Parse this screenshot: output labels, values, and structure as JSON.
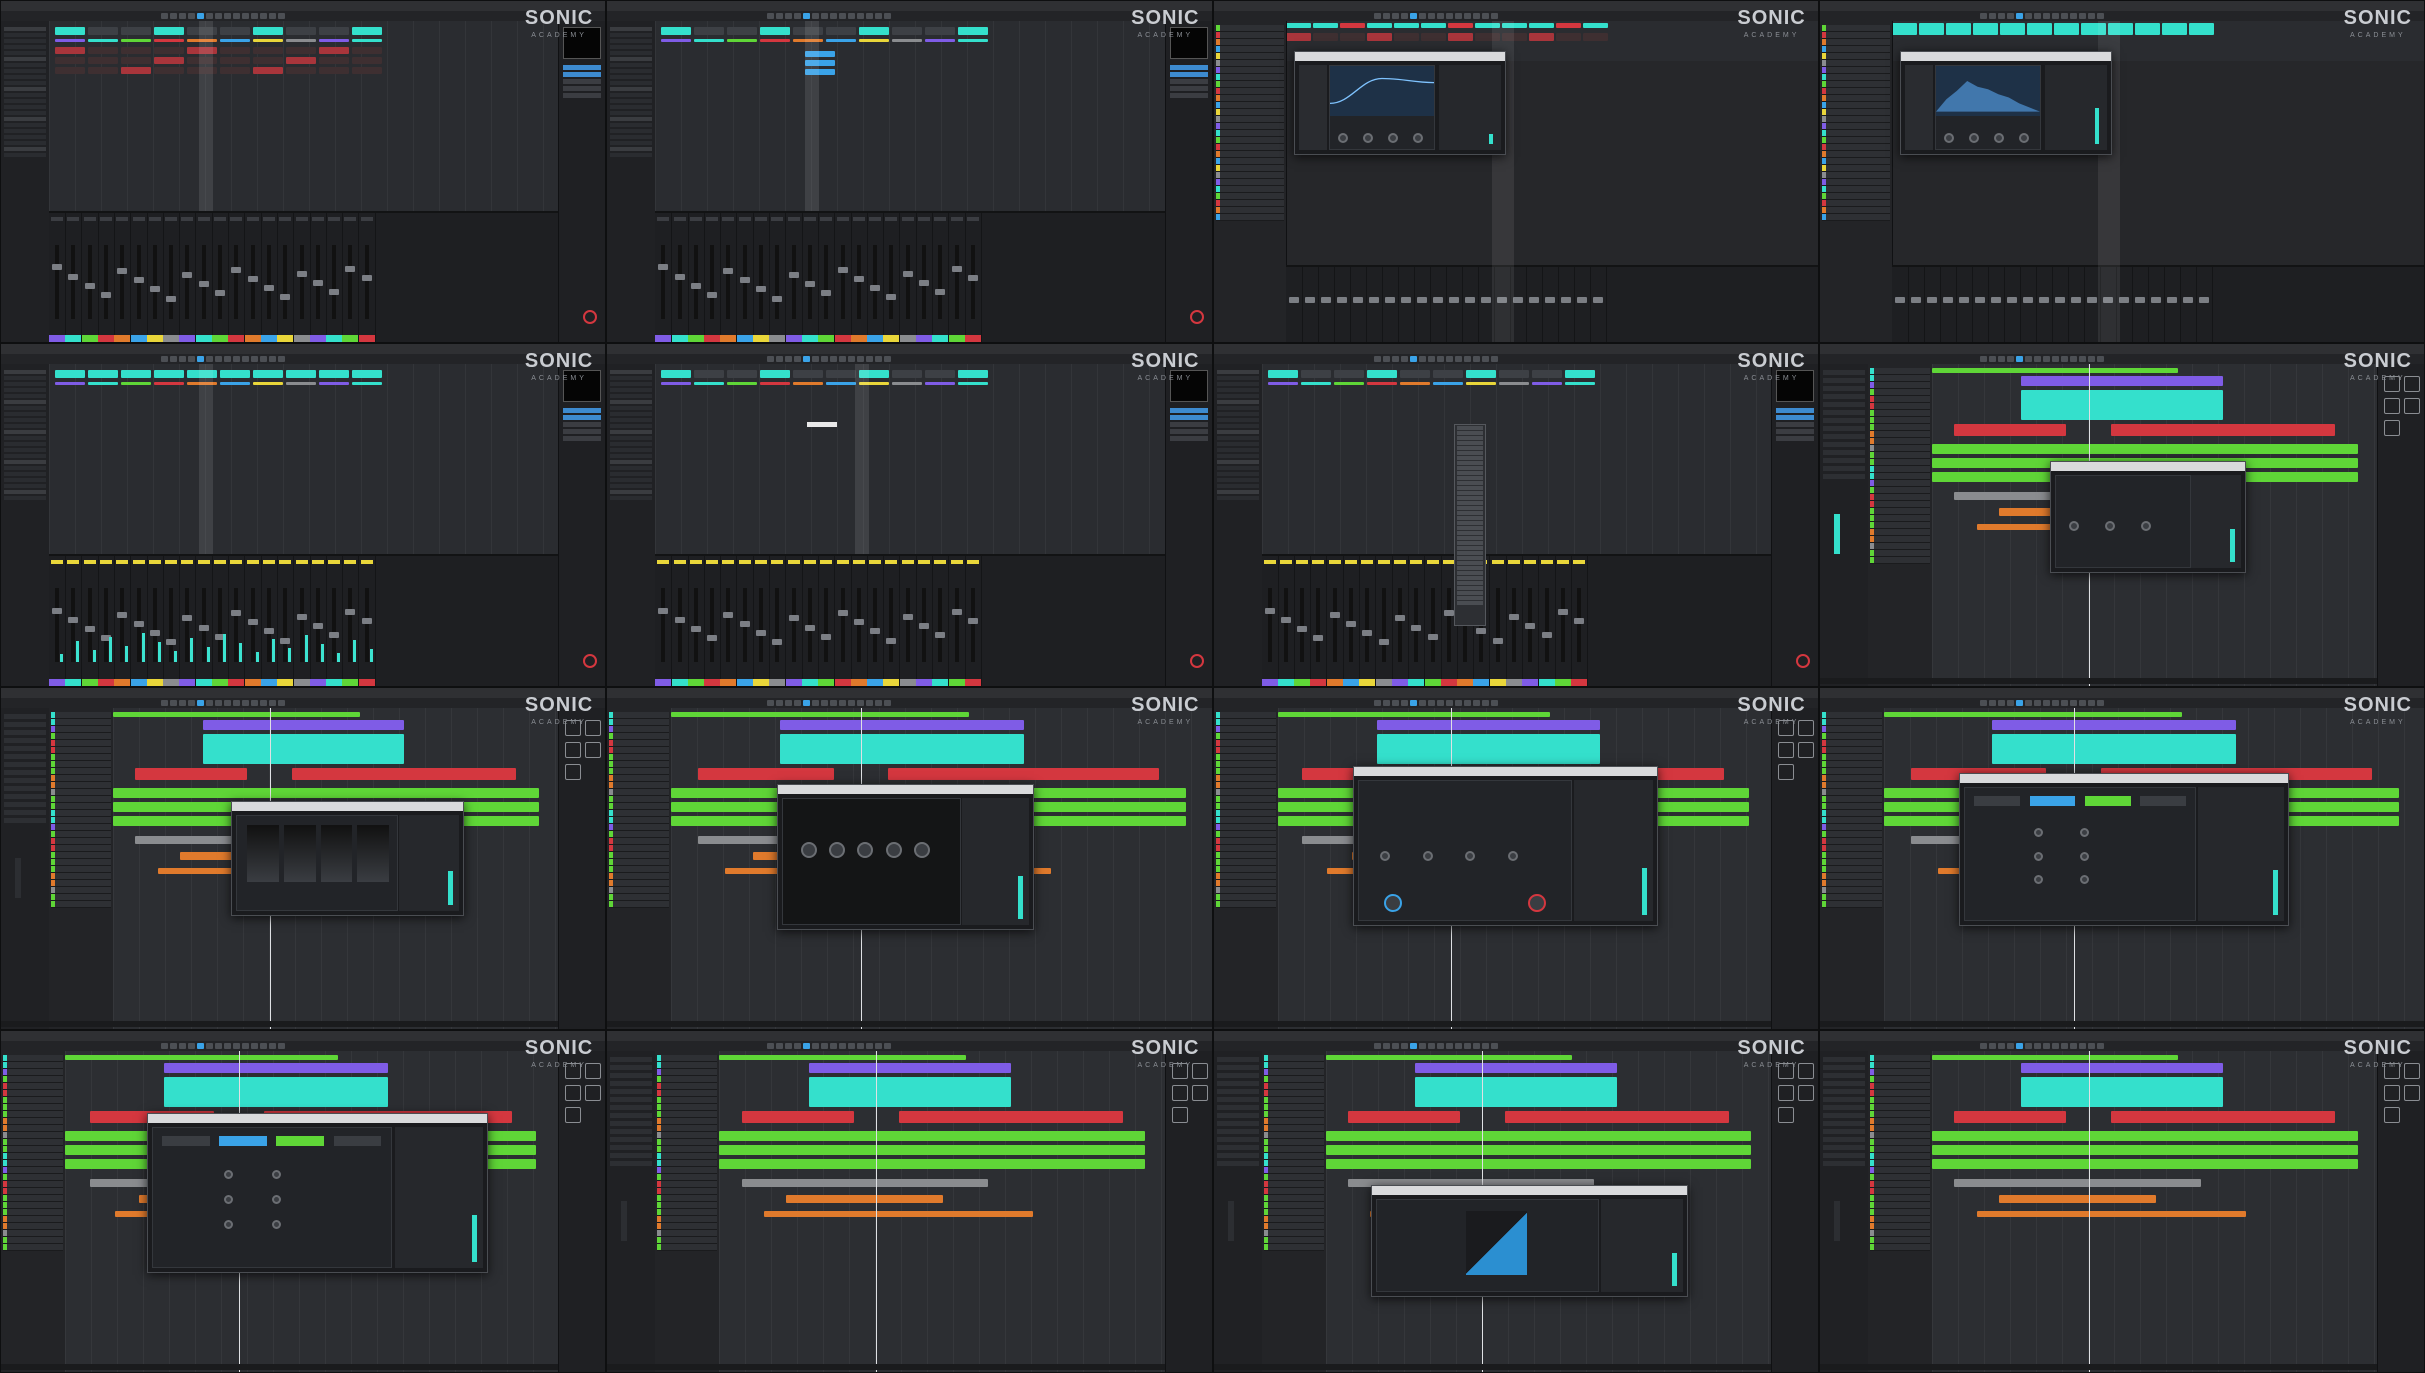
{
  "logo": {
    "main": "SONIC",
    "sub": "ACADEMY"
  },
  "tiles": [
    {
      "kind": "mixer",
      "variant": "red-tracks"
    },
    {
      "kind": "mixer",
      "variant": "blue-clips"
    },
    {
      "kind": "plugin-eq",
      "variant": "curve"
    },
    {
      "kind": "plugin-eq",
      "variant": "spectrum"
    },
    {
      "kind": "mixer",
      "variant": "cyan-meters"
    },
    {
      "kind": "mixer",
      "variant": "selected"
    },
    {
      "kind": "mixer",
      "variant": "context-menu"
    },
    {
      "kind": "arrange",
      "variant": "plugin-small"
    },
    {
      "kind": "arrange",
      "variant": "plugin-bars"
    },
    {
      "kind": "arrange",
      "variant": "plugin-knobs"
    },
    {
      "kind": "arrange",
      "variant": "plugin-compressor"
    },
    {
      "kind": "arrange",
      "variant": "plugin-strip"
    },
    {
      "kind": "arrange",
      "variant": "plugin-strip-2"
    },
    {
      "kind": "arrange",
      "variant": "plain"
    },
    {
      "kind": "arrange",
      "variant": "plugin-env"
    },
    {
      "kind": "arrange",
      "variant": "plain-2"
    }
  ],
  "colors": {
    "cyan": "#34e0cc",
    "purple": "#7f5ce6",
    "green": "#5fd637",
    "red": "#d4373f",
    "orange": "#e07a2c",
    "grey": "#8a8c8f",
    "blue": "#3aa3e8",
    "yellow": "#e9d63a"
  },
  "right_icons": [
    "mixer-icon",
    "fx-icon",
    "link-icon",
    "record-icon",
    "star-icon"
  ]
}
